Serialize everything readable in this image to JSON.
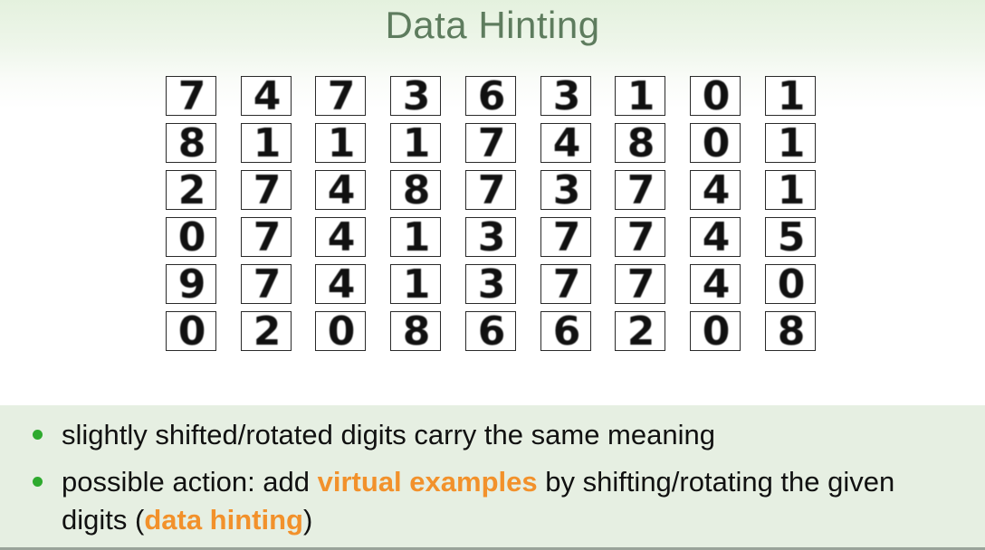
{
  "slide": {
    "title": "Data Hinting"
  },
  "digits": [
    [
      "7",
      "4",
      "7",
      "3",
      "6",
      "3",
      "1",
      "0",
      "1"
    ],
    [
      "8",
      "1",
      "1",
      "1",
      "7",
      "4",
      "8",
      "0",
      "1"
    ],
    [
      "2",
      "7",
      "4",
      "8",
      "7",
      "3",
      "7",
      "4",
      "1"
    ],
    [
      "0",
      "7",
      "4",
      "1",
      "3",
      "7",
      "7",
      "4",
      "5"
    ],
    [
      "9",
      "7",
      "4",
      "1",
      "3",
      "7",
      "7",
      "4",
      "0"
    ],
    [
      "0",
      "2",
      "0",
      "8",
      "6",
      "6",
      "2",
      "0",
      "8"
    ]
  ],
  "bullets": {
    "b1": {
      "text": "slightly shifted/rotated digits carry the same meaning"
    },
    "b2": {
      "pre": "possible action: add ",
      "hl1": "virtual examples",
      "mid": " by shifting/rotating the given digits (",
      "hl2": "data hinting",
      "post": ")"
    }
  },
  "colors": {
    "title": "#5e7c5e",
    "highlight": "#f2912b",
    "bullet": "#2eaa2e",
    "panel": "#e6efe2"
  }
}
